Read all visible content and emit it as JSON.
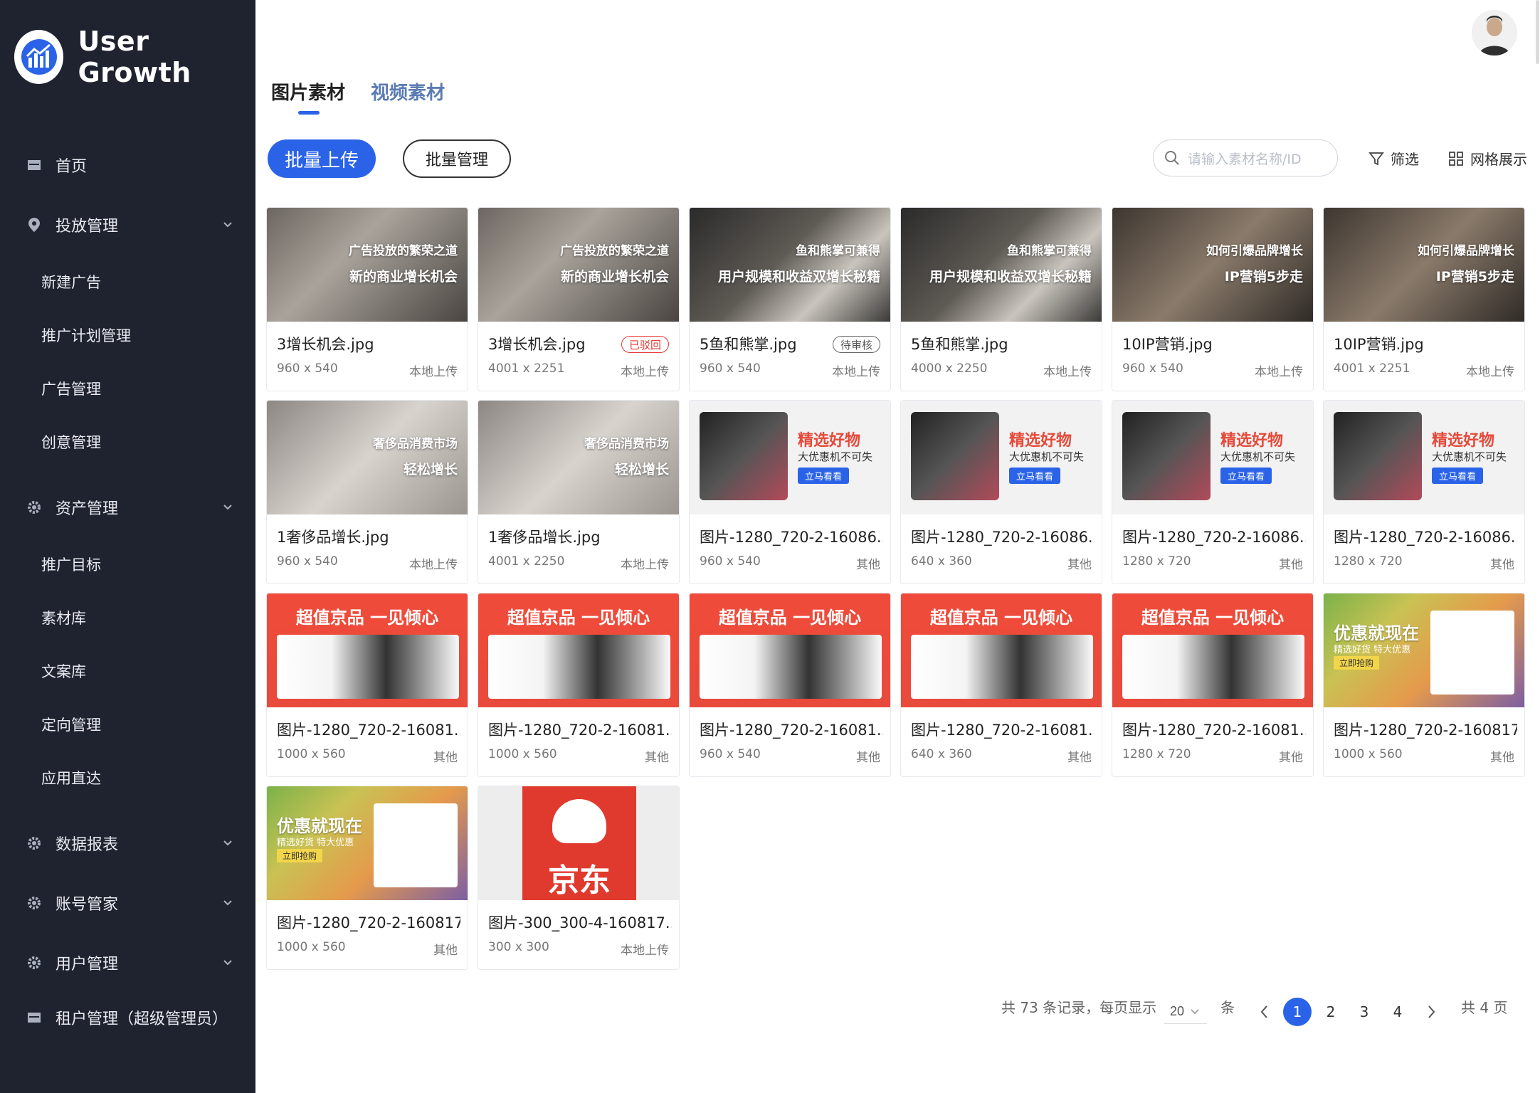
{
  "brand": {
    "title": "User Growth"
  },
  "sidebar": {
    "items": [
      {
        "label": "首页",
        "icon": "home-icon"
      },
      {
        "label": "投放管理",
        "icon": "location-pin-icon",
        "expandable": true
      },
      {
        "label": "新建广告"
      },
      {
        "label": "推广计划管理"
      },
      {
        "label": "广告管理"
      },
      {
        "label": "创意管理"
      },
      {
        "label": "资产管理",
        "icon": "gear-icon",
        "expandable": true
      },
      {
        "label": "推广目标"
      },
      {
        "label": "素材库"
      },
      {
        "label": "文案库"
      },
      {
        "label": "定向管理"
      },
      {
        "label": "应用直达"
      },
      {
        "label": "数据报表",
        "icon": "gear-icon",
        "expandable": true
      },
      {
        "label": "账号管家",
        "icon": "gear-icon",
        "expandable": true
      },
      {
        "label": "用户管理",
        "icon": "gear-icon",
        "expandable": true
      },
      {
        "label": "租户管理（超级管理员）",
        "icon": "home-icon"
      }
    ]
  },
  "tabs": {
    "images": "图片素材",
    "videos": "视频素材"
  },
  "toolbar": {
    "bulk_upload": "批量上传",
    "bulk_manage": "批量管理",
    "search_placeholder": "请输入素材名称/ID",
    "filter": "筛选",
    "grid_view": "网格展示"
  },
  "cards": [
    {
      "name": "3增长机会.jpg",
      "dims": "960 x 540",
      "source": "本地上传",
      "badge": "",
      "thumb_text": [
        "广告投放的繁荣之道",
        "新的商业增长机会"
      ]
    },
    {
      "name": "3增长机会.jpg",
      "dims": "4001 x 2251",
      "source": "本地上传",
      "badge": "已驳回",
      "thumb_text": [
        "广告投放的繁荣之道",
        "新的商业增长机会"
      ]
    },
    {
      "name": "5鱼和熊掌.jpg",
      "dims": "960 x 540",
      "source": "本地上传",
      "badge": "待审核",
      "thumb_text": [
        "鱼和熊掌可兼得",
        "用户规模和收益双增长秘籍"
      ]
    },
    {
      "name": "5鱼和熊掌.jpg",
      "dims": "4000 x 2250",
      "source": "本地上传",
      "badge": "",
      "thumb_text": [
        "鱼和熊掌可兼得",
        "用户规模和收益双增长秘籍"
      ]
    },
    {
      "name": "10IP营销.jpg",
      "dims": "960 x 540",
      "source": "本地上传",
      "badge": "",
      "thumb_text": [
        "如何引爆品牌增长",
        "IP营销5步走"
      ]
    },
    {
      "name": "10IP营销.jpg",
      "dims": "4001 x 2251",
      "source": "本地上传",
      "badge": "",
      "thumb_text": [
        "如何引爆品牌增长",
        "IP营销5步走"
      ]
    },
    {
      "name": "1奢侈品增长.jpg",
      "dims": "960 x 540",
      "source": "本地上传",
      "badge": "",
      "thumb_text": [
        "奢侈品消费市场",
        "轻松增长"
      ]
    },
    {
      "name": "1奢侈品增长.jpg",
      "dims": "4001 x 2250",
      "source": "本地上传",
      "badge": "",
      "thumb_text": [
        "奢侈品消费市场",
        "轻松增长"
      ]
    },
    {
      "name": "图片-1280_720-2-16086...",
      "dims": "960 x 540",
      "source": "其他",
      "badge": "",
      "thumb_text": [
        "精选好物",
        "大优惠机不可失",
        "立马看看"
      ]
    },
    {
      "name": "图片-1280_720-2-16086...",
      "dims": "640 x 360",
      "source": "其他",
      "badge": "",
      "thumb_text": [
        "精选好物",
        "大优惠机不可失",
        "立马看看"
      ]
    },
    {
      "name": "图片-1280_720-2-16086...",
      "dims": "1280 x 720",
      "source": "其他",
      "badge": "",
      "thumb_text": [
        "精选好物",
        "大优惠机不可失",
        "立马看看"
      ]
    },
    {
      "name": "图片-1280_720-2-16086...",
      "dims": "1280 x 720",
      "source": "其他",
      "badge": "",
      "thumb_text": [
        "精选好物",
        "大优惠机不可失",
        "立马看看"
      ]
    },
    {
      "name": "图片-1280_720-2-16081...",
      "dims": "1000 x 560",
      "source": "其他",
      "badge": "",
      "thumb_text": [
        "超值京品 一见倾心"
      ]
    },
    {
      "name": "图片-1280_720-2-16081...",
      "dims": "1000 x 560",
      "source": "其他",
      "badge": "",
      "thumb_text": [
        "超值京品 一见倾心"
      ]
    },
    {
      "name": "图片-1280_720-2-16081...",
      "dims": "960 x 540",
      "source": "其他",
      "badge": "",
      "thumb_text": [
        "超值京品 一见倾心"
      ]
    },
    {
      "name": "图片-1280_720-2-16081...",
      "dims": "640 x 360",
      "source": "其他",
      "badge": "",
      "thumb_text": [
        "超值京品 一见倾心"
      ]
    },
    {
      "name": "图片-1280_720-2-16081...",
      "dims": "1280 x 720",
      "source": "其他",
      "badge": "",
      "thumb_text": [
        "超值京品 一见倾心"
      ]
    },
    {
      "name": "图片-1280_720-2-160817...",
      "dims": "1000 x 560",
      "source": "其他",
      "badge": "",
      "thumb_text": [
        "优惠就现在",
        "精选好货 特大优惠",
        "立即抢购"
      ]
    },
    {
      "name": "图片-1280_720-2-160817...",
      "dims": "1000 x 560",
      "source": "其他",
      "badge": "",
      "thumb_text": [
        "优惠就现在",
        "精选好货 特大优惠",
        "立即抢购"
      ]
    },
    {
      "name": "图片-300_300-4-160817...",
      "dims": "300 x 300",
      "source": "本地上传",
      "badge": "",
      "thumb_text": [
        "京东"
      ]
    }
  ],
  "pagination": {
    "summary": "共 73 条记录，每页显示",
    "page_size": "20",
    "unit": "条",
    "pages": [
      "1",
      "2",
      "3",
      "4"
    ],
    "current": "1",
    "total_pages": "共 4 页"
  },
  "colors": {
    "sidebar_bg": "#1f2330",
    "accent": "#2a63e8",
    "rejected": "#e53935"
  }
}
